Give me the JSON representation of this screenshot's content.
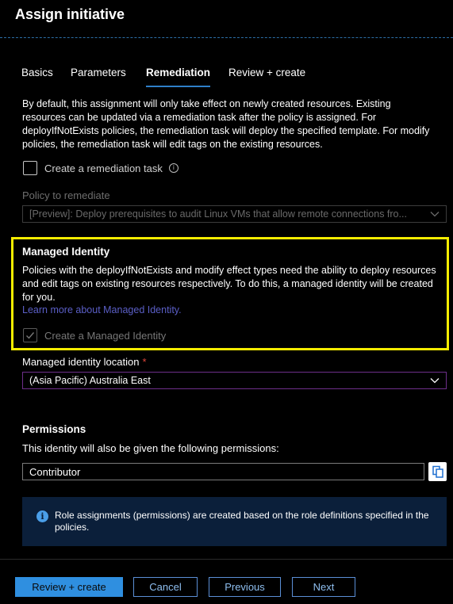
{
  "header": {
    "title": "Assign initiative"
  },
  "tabs": [
    {
      "label": "Basics",
      "active": false
    },
    {
      "label": "Parameters",
      "active": false
    },
    {
      "label": "Remediation",
      "active": true
    },
    {
      "label": "Review + create",
      "active": false
    }
  ],
  "description": "By default, this assignment will only take effect on newly created resources. Existing resources can be updated via a remediation task after the policy is assigned. For deployIfNotExists policies, the remediation task will deploy the specified template. For modify policies, the remediation task will edit tags on the existing resources.",
  "remediation_task": {
    "label": "Create a remediation task",
    "checked": false,
    "info_icon": "info-circle-icon"
  },
  "policy_to_remediate": {
    "label": "Policy to remediate",
    "value": "[Preview]: Deploy prerequisites to audit Linux VMs that allow remote connections fro...",
    "disabled": true
  },
  "managed_identity": {
    "title": "Managed Identity",
    "text": "Policies with the deployIfNotExists and modify effect types need the ability to deploy resources and edit tags on existing resources respectively. To do this, a managed identity will be created for you.",
    "link": "Learn more about Managed Identity.",
    "checkbox_label": "Create a Managed Identity",
    "checked": true,
    "highlight_color": "#f5ec00"
  },
  "identity_location": {
    "label": "Managed identity location",
    "required_mark": "*",
    "value": "(Asia Pacific) Australia East"
  },
  "permissions": {
    "title": "Permissions",
    "text": "This identity will also be given the following permissions:",
    "value": "Contributor",
    "copy_icon": "copy-icon"
  },
  "info_banner": {
    "icon": "info-icon",
    "icon_glyph": "i",
    "text": "Role assignments (permissions) are created based on the role definitions specified in the policies."
  },
  "footer": {
    "review_create": "Review + create",
    "cancel": "Cancel",
    "previous": "Previous",
    "next": "Next"
  },
  "colors": {
    "background": "#000000",
    "accent": "#2f8fe0",
    "link": "#5b5fc7",
    "required": "#e0453a",
    "banner": "#0b1f3a"
  }
}
